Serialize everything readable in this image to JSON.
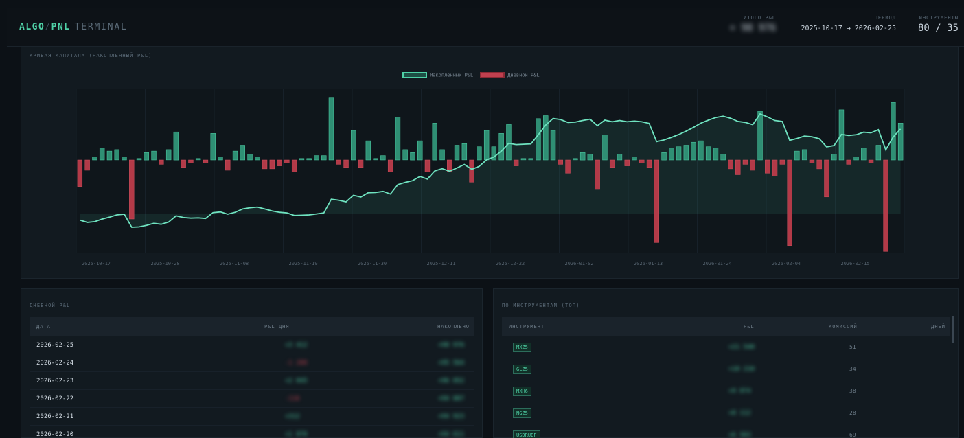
{
  "app": {
    "brand_algo": "ALGO",
    "brand_slash": "/",
    "brand_pnl": "PNL",
    "brand_terminal": "TERMINAL"
  },
  "header": {
    "total_pnl_label": "ИТОГО P&L",
    "total_pnl_value": "+ 98 976",
    "period_label": "ПЕРИОД",
    "period_value": "2025-10-17 → 2026-02-25",
    "instruments_label": "ИНСТРУМЕНТЫ",
    "instruments_value": "80 / 35"
  },
  "chart_panel": {
    "title": "КРИВАЯ КАПИТАЛА (НАКОПЛЕННЫЙ P&L)"
  },
  "colors": {
    "accent": "#4fd1a7",
    "negative": "#c0404f",
    "background": "#0c1116",
    "panel": "#121a20"
  },
  "chart_data": {
    "type": "bar",
    "legend": [
      "Накопленный P&L",
      "Дневной P&L"
    ],
    "legend_position": "top-center",
    "x_tick_labels": [
      "2025-10-17",
      "2025-10-28",
      "2025-11-08",
      "2025-11-19",
      "2025-11-30",
      "2025-12-11",
      "2025-12-22",
      "2026-01-02",
      "2026-01-13",
      "2026-01-24",
      "2026-02-04",
      "2026-02-15"
    ],
    "daily_pnl": [
      -18,
      -7,
      2,
      8,
      6,
      7,
      2,
      -40,
      1,
      5,
      6,
      -3,
      7,
      19,
      -5,
      -2,
      1,
      -2,
      18,
      2,
      -7,
      6,
      10,
      4,
      2,
      -6,
      -6,
      -4,
      -2,
      -8,
      1,
      1,
      3,
      3,
      42,
      -3,
      -5,
      20,
      -5,
      13,
      1,
      3,
      -8,
      29,
      7,
      5,
      13,
      -8,
      25,
      7,
      -8,
      10,
      11,
      -15,
      9,
      20,
      9,
      18,
      24,
      -4,
      1,
      1,
      28,
      30,
      20,
      -3,
      -9,
      1,
      5,
      4,
      -20,
      17,
      -5,
      4,
      -4,
      2,
      -2,
      -5,
      -56,
      5,
      8,
      9,
      10,
      12,
      13,
      9,
      8,
      4,
      -6,
      -10,
      -3,
      -7,
      33,
      -9,
      -11,
      -3,
      -58,
      6,
      7,
      -2,
      -6,
      -25,
      4,
      34,
      -3,
      2,
      8,
      -2,
      10,
      -62,
      39,
      25
    ]
  },
  "daily_table": {
    "title": "ДНЕВНОЙ P&L",
    "headers": [
      "ДАТА",
      "P&L ДНЯ",
      "НАКОПЛЕНО"
    ],
    "rows": [
      {
        "date": "2026-02-25",
        "pnl": "+3 412",
        "cum": "+98 976"
      },
      {
        "date": "2026-02-24",
        "pnl": "-1 288",
        "cum": "+95 564"
      },
      {
        "date": "2026-02-23",
        "pnl": "+2 045",
        "cum": "+96 852"
      },
      {
        "date": "2026-02-22",
        "pnl": "-116",
        "cum": "+94 807"
      },
      {
        "date": "2026-02-21",
        "pnl": "+312",
        "cum": "+94 923"
      },
      {
        "date": "2026-02-20",
        "pnl": "+1 870",
        "cum": "+94 611"
      }
    ]
  },
  "instruments_table": {
    "title": "ПО ИНСТРУМЕНТАМ (ТОП)",
    "headers": [
      "ИНСТРУМЕНТ",
      "P&L",
      "КОМИССИЙ",
      "ДНЕЙ"
    ],
    "rows": [
      {
        "name": "MXZ5",
        "pnl": "+21 540",
        "fees": "51"
      },
      {
        "name": "GLZ5",
        "pnl": "+18 210",
        "fees": "34"
      },
      {
        "name": "MXH6",
        "pnl": "+9 874",
        "fees": "38"
      },
      {
        "name": "NGZ5",
        "pnl": "+8 112",
        "fees": "28"
      },
      {
        "name": "USDRUBF",
        "pnl": "+6 503",
        "fees": "69"
      }
    ]
  }
}
